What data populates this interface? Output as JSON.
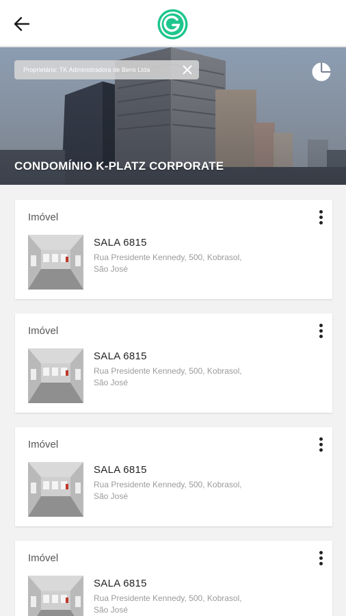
{
  "header": {
    "back_icon": "arrow-left-icon",
    "logo_icon": "g-logo-icon",
    "brand_color": "#1ec68e"
  },
  "hero": {
    "owner_chip": "Proprietário: TK Administradora de Bens Ltda",
    "chip_close_icon": "close-icon",
    "chart_icon": "pie-chart-icon",
    "title": "CONDOMÍNIO K-PLATZ CORPORATE"
  },
  "cards": [
    {
      "type": "Imóvel",
      "title": "SALA 6815",
      "address_line1": "Rua Presidente Kennedy, 500, Kobrasol,",
      "address_line2": "São José"
    },
    {
      "type": "Imóvel",
      "title": "SALA 6815",
      "address_line1": "Rua Presidente Kennedy, 500, Kobrasol,",
      "address_line2": "São José"
    },
    {
      "type": "Imóvel",
      "title": "SALA 6815",
      "address_line1": "Rua Presidente Kennedy, 500, Kobrasol,",
      "address_line2": "São José"
    },
    {
      "type": "Imóvel",
      "title": "SALA 6815",
      "address_line1": "Rua Presidente Kennedy, 500, Kobrasol,",
      "address_line2": "São José"
    }
  ]
}
